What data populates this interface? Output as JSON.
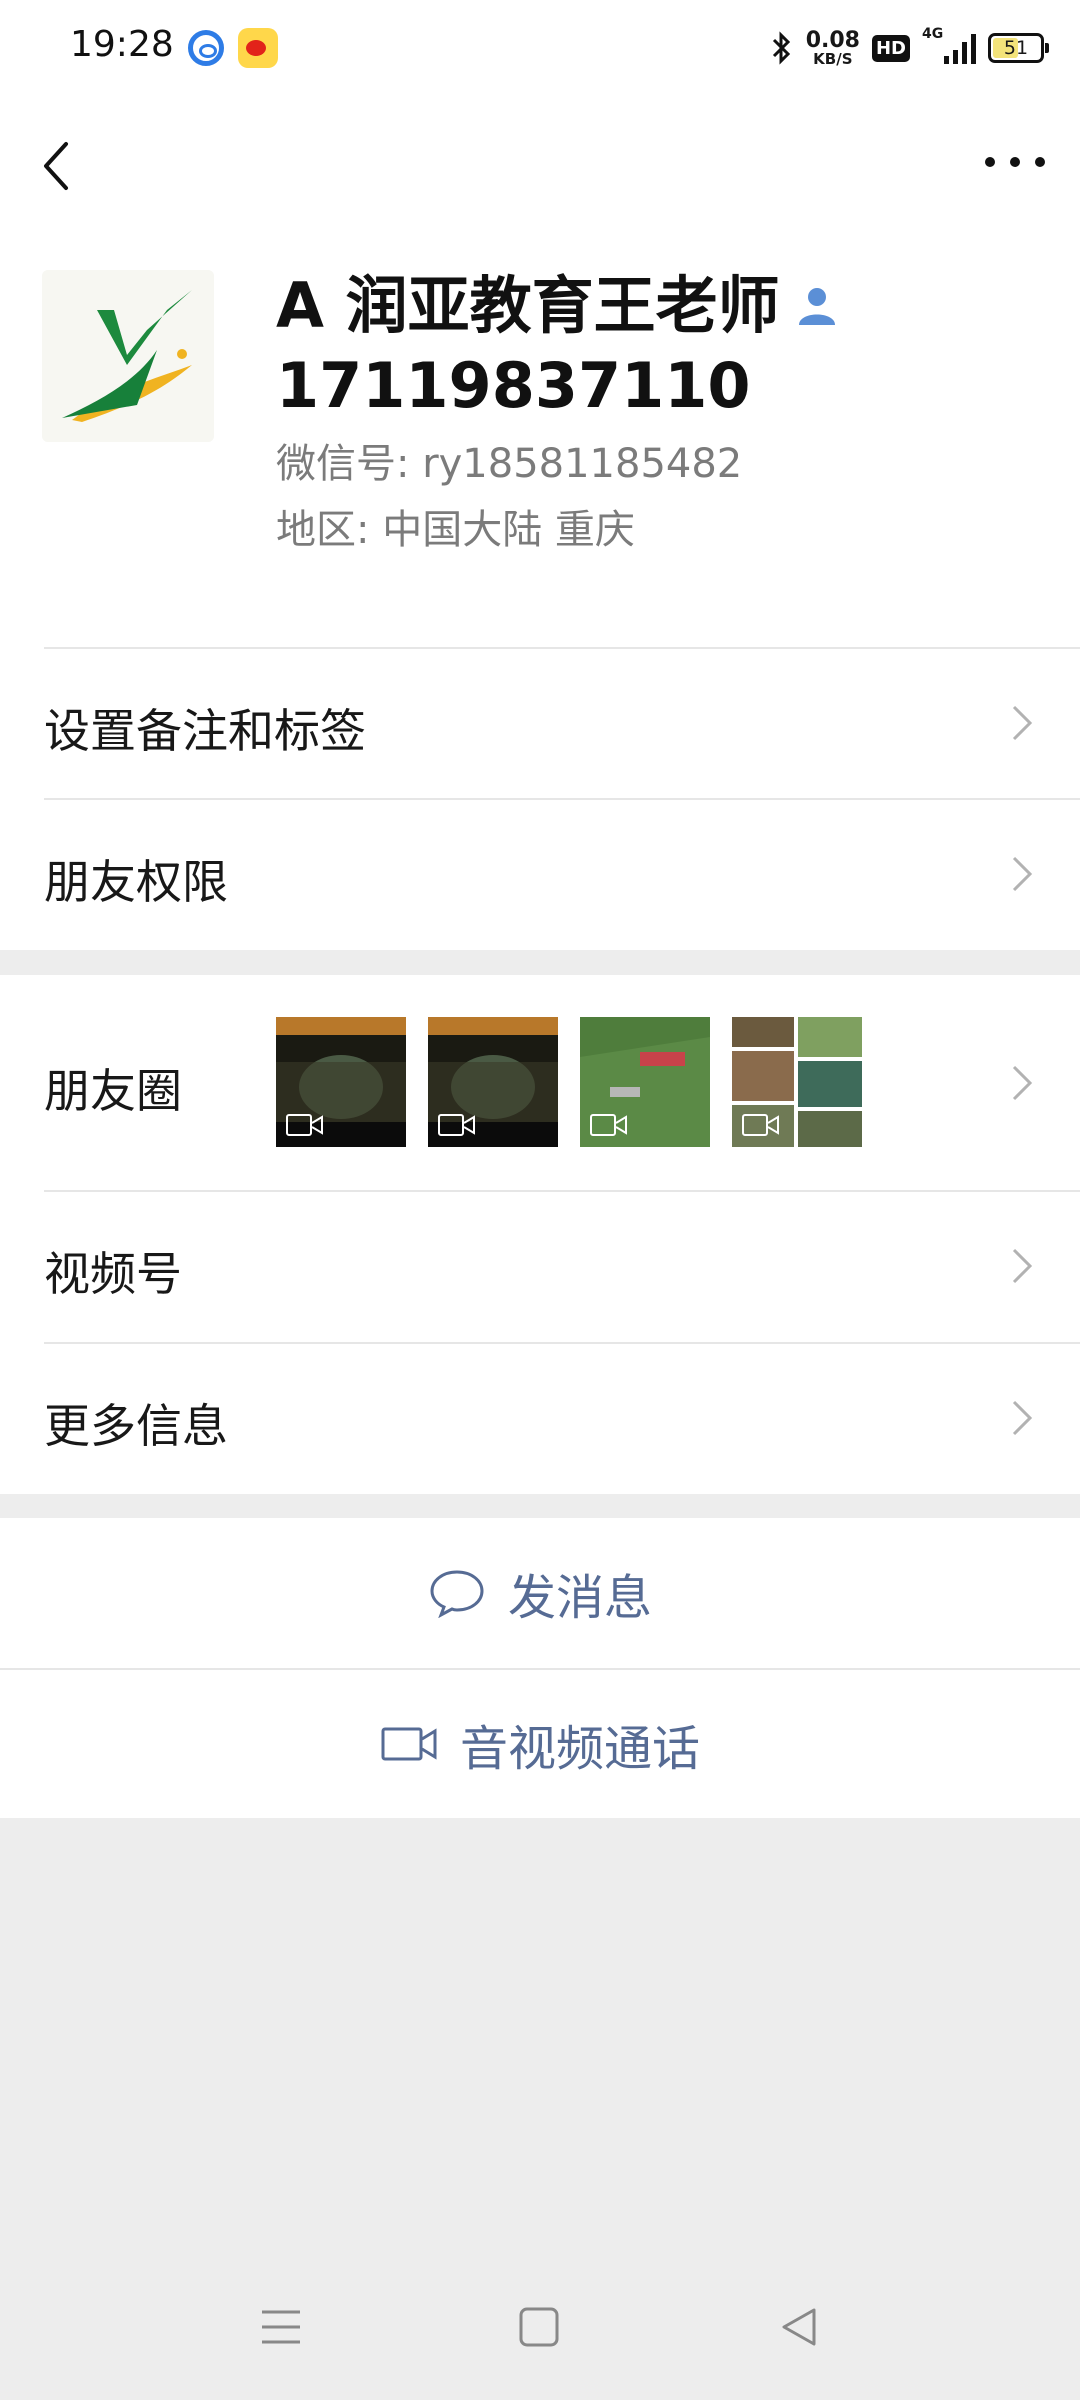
{
  "status_bar": {
    "time": "19:28",
    "net_speed": "0.08",
    "net_speed_unit": "KB/S",
    "hd_badge": "HD",
    "network": "4G",
    "battery": "51"
  },
  "profile": {
    "name": "A 润亚教育王老师",
    "phone": "17119837110",
    "wechat_id": "微信号:  ry18581185482",
    "region": "地区:  中国大陆  重庆"
  },
  "menu": {
    "remark_tags": "设置备注和标签",
    "friend_permissions": "朋友权限",
    "moments": "朋友圈",
    "channels": "视频号",
    "more_info": "更多信息"
  },
  "actions": {
    "send_message": "发消息",
    "av_call": "音视频通话"
  },
  "colors": {
    "action_text": "#566b94",
    "background": "#ededed"
  }
}
